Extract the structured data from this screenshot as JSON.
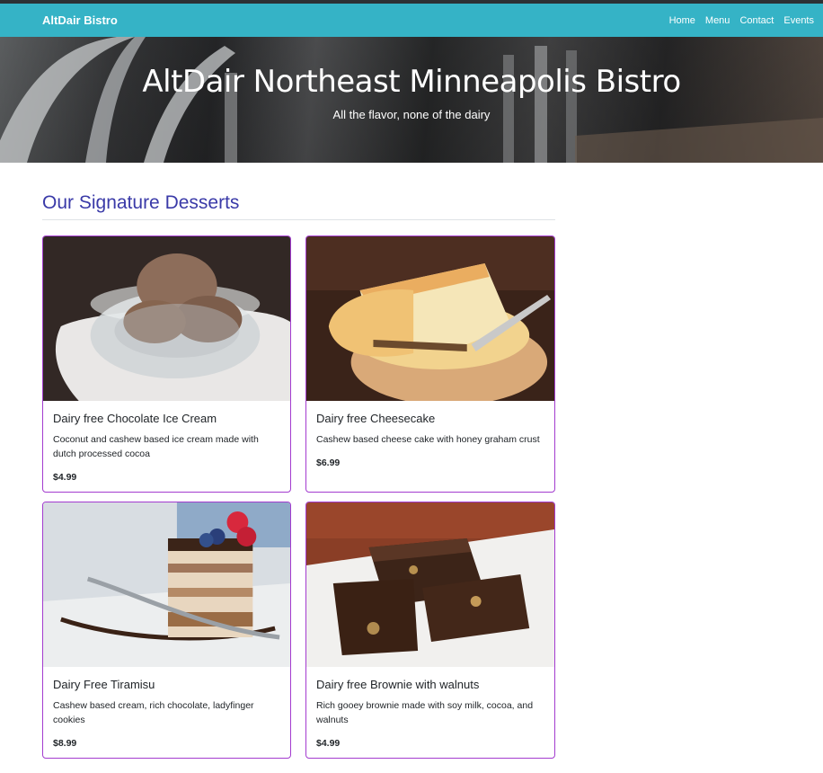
{
  "nav": {
    "brand": "AltDair Bistro",
    "links": [
      "Home",
      "Menu",
      "Contact",
      "Events"
    ]
  },
  "hero": {
    "title": "AltDair Northeast Minneapolis Bistro",
    "subtitle": "All the flavor, none of the dairy"
  },
  "section": {
    "title": "Our Signature Desserts"
  },
  "cards": [
    {
      "title": "Dairy free Chocolate Ice Cream",
      "description": "Coconut and cashew based ice cream made with dutch processed cocoa",
      "price": "$4.99",
      "image": "chocolate-ice-cream-photo"
    },
    {
      "title": "Dairy free Cheesecake",
      "description": "Cashew based cheese cake with honey graham crust",
      "price": "$6.99",
      "image": "cheesecake-photo"
    },
    {
      "title": "Dairy Free Tiramisu",
      "description": "Cashew based cream, rich chocolate, ladyfinger cookies",
      "price": "$8.99",
      "image": "tiramisu-photo"
    },
    {
      "title": "Dairy free Brownie with walnuts",
      "description": "Rich gooey brownie made with soy milk, cocoa, and walnuts",
      "price": "$4.99",
      "image": "brownie-photo"
    }
  ],
  "colors": {
    "navbar": "#35b3c6",
    "section_title": "#3a3aa8",
    "card_border": "#a33bcf"
  }
}
